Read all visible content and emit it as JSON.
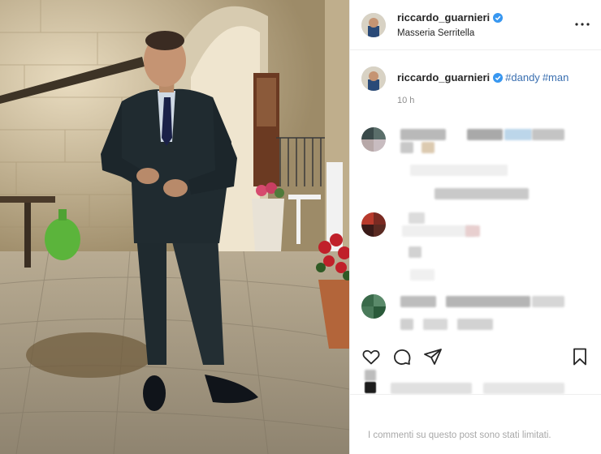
{
  "post": {
    "username": "riccardo_guarnieri",
    "location": "Masseria Serritella",
    "more_icon": "more-horizontal-icon",
    "caption": {
      "username": "riccardo_guarnieri",
      "hashtags": [
        "#dandy",
        "#man"
      ],
      "time": "10 h"
    },
    "actions": {
      "like_icon": "heart-icon",
      "comment_icon": "comment-bubble-icon",
      "share_icon": "paper-plane-icon",
      "save_icon": "bookmark-icon"
    },
    "comments_limited": "I commenti su questo post sono stati limitati.",
    "colors": {
      "verified": "#3897f0",
      "hashtag": "#3a6fb0",
      "muted": "#a8a8a8",
      "text": "#262626"
    }
  }
}
